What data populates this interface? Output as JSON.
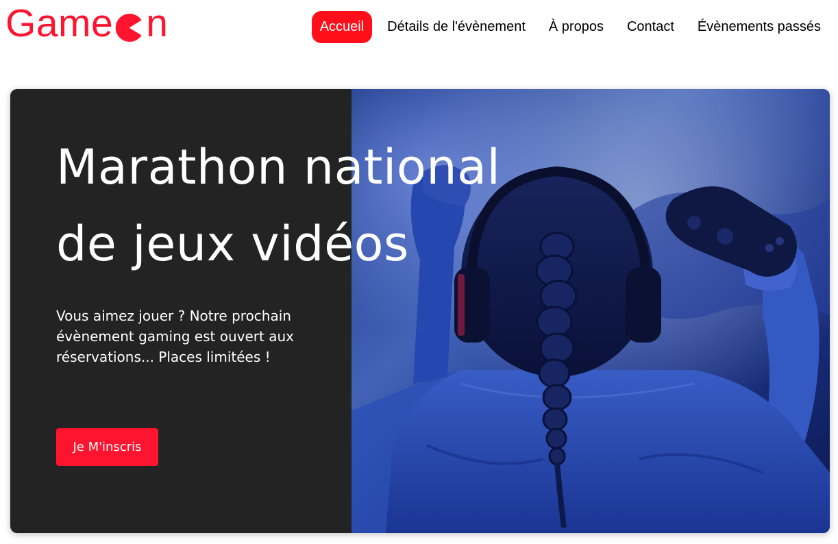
{
  "header": {
    "logo": {
      "text_before": "Game",
      "text_after": "n",
      "icon": "pacman-icon",
      "color": "#fe142f"
    },
    "nav": [
      {
        "label": "Accueil",
        "active": true
      },
      {
        "label": "Détails de l'évènement",
        "active": false
      },
      {
        "label": "À propos",
        "active": false
      },
      {
        "label": "Contact",
        "active": false
      },
      {
        "label": "Évènements passés",
        "active": false
      }
    ],
    "active_color": "#fe0f1a"
  },
  "hero": {
    "title": "Marathon national\nde jeux vidéos",
    "text": "Vous aimez jouer ? Notre prochain évènement gaming est ouvert aux réservations... Places limitées !",
    "button_label": "Je M'inscris",
    "button_color": "#fe142f",
    "background_color": "#232323"
  }
}
